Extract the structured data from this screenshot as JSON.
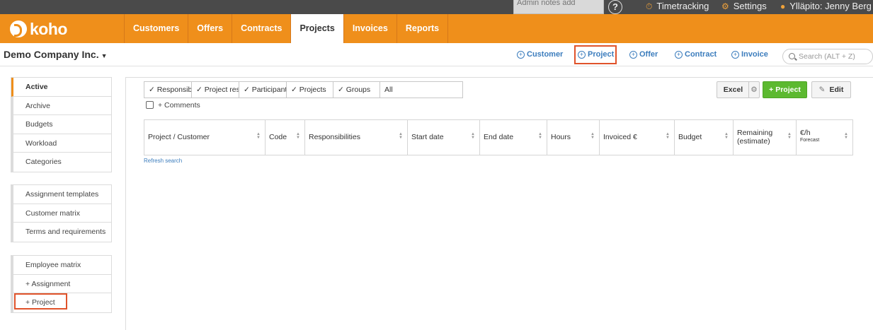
{
  "topbar": {
    "admin_notes_placeholder": "Admin notes add",
    "help_icon": "question-circle-icon",
    "timetracking": "Timetracking",
    "timetracking_icon": "stopwatch-icon",
    "settings": "Settings",
    "settings_icon": "gear-icon",
    "user": "Ylläpito: Jenny Berg",
    "user_icon": "person-icon"
  },
  "brand": {
    "logo_text": "koho",
    "color": "#ef8f1b"
  },
  "nav": {
    "items": [
      "Customers",
      "Offers",
      "Contracts",
      "Projects",
      "Invoices",
      "Reports"
    ],
    "active": "Projects"
  },
  "subheader": {
    "company": "Demo Company Inc.",
    "quick_actions": [
      "Customer",
      "Project",
      "Offer",
      "Contract",
      "Invoice"
    ],
    "search_placeholder": "Search (ALT + Z)"
  },
  "sidebar": {
    "group1": [
      "Active",
      "Archive",
      "Budgets",
      "Workload",
      "Categories"
    ],
    "group2": [
      "Assignment templates",
      "Customer matrix",
      "Terms and requirements"
    ],
    "group3": [
      "Employee matrix",
      "+ Assignment",
      "+ Project"
    ],
    "active": "Active"
  },
  "filters": [
    "✓ Responsib.",
    "✓ Project res.",
    "✓ Participant",
    "✓ Projects",
    "✓ Groups",
    "All"
  ],
  "comments_label": "+ Comments",
  "buttons": {
    "excel": "Excel",
    "settings_icon": "gear-icon",
    "add_project": "+ Project",
    "edit": "Edit",
    "edit_icon": "pencil-icon"
  },
  "table": {
    "columns": [
      "Project / Customer",
      "Code",
      "Responsibilities",
      "Start date",
      "End date",
      "Hours",
      "Invoiced €",
      "Budget"
    ],
    "remaining_label_1": "Remaining",
    "remaining_label_2": "(estimate)",
    "rate_label": "€/h",
    "rate_sub": "Forecast"
  },
  "refresh_link": "Refresh search"
}
